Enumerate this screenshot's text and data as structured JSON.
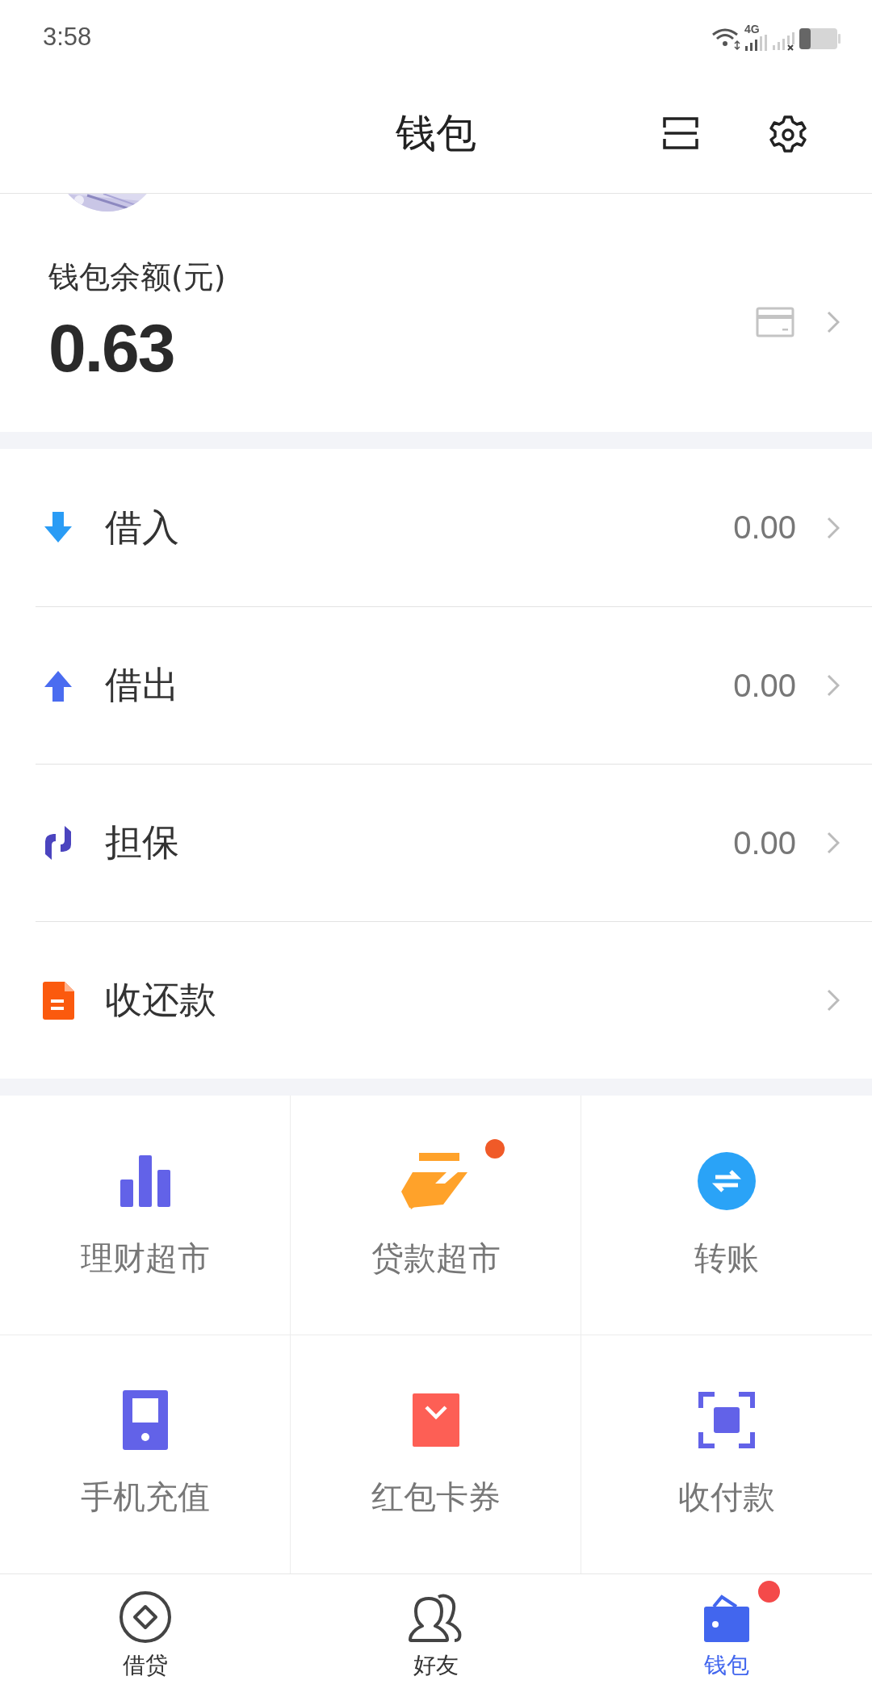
{
  "status_bar": {
    "time": "3:58",
    "network": "4G"
  },
  "header": {
    "title": "钱包"
  },
  "balance": {
    "label": "钱包余额(元)",
    "amount": "0.63"
  },
  "rows": [
    {
      "kind": "down",
      "label": "借入",
      "value": "0.00"
    },
    {
      "kind": "up",
      "label": "借出",
      "value": "0.00"
    },
    {
      "kind": "guarantee",
      "label": "担保",
      "value": "0.00"
    },
    {
      "kind": "doc",
      "label": "收还款"
    }
  ],
  "grid": [
    {
      "kind": "bars",
      "label": "理财超市",
      "badge": false
    },
    {
      "kind": "hand",
      "label": "贷款超市",
      "badge": true
    },
    {
      "kind": "transfer",
      "label": "转账",
      "badge": false
    },
    {
      "kind": "phone",
      "label": "手机充值",
      "badge": false
    },
    {
      "kind": "envelope",
      "label": "红包卡券",
      "badge": false
    },
    {
      "kind": "scan",
      "label": "收付款",
      "badge": false
    }
  ],
  "tabs": [
    {
      "kind": "loan",
      "label": "借贷",
      "selected": false,
      "badge": false
    },
    {
      "kind": "friends",
      "label": "好友",
      "selected": false,
      "badge": false
    },
    {
      "kind": "wallet",
      "label": "钱包",
      "selected": true,
      "badge": true
    }
  ]
}
